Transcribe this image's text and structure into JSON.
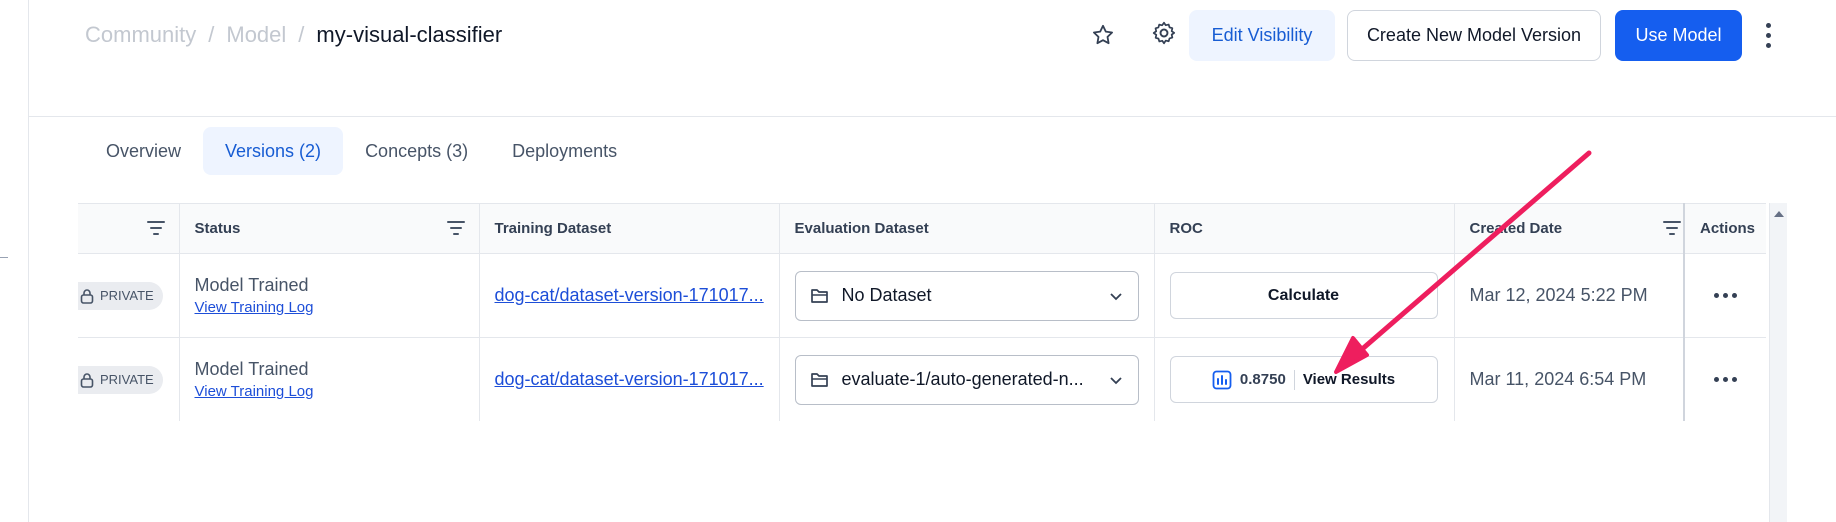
{
  "header": {
    "breadcrumb": [
      "Community",
      "Model",
      "my-visual-classifier"
    ],
    "separator": "/",
    "edit_visibility_label": "Edit Visibility",
    "create_version_label": "Create New Model Version",
    "use_model_label": "Use Model"
  },
  "tabs": [
    {
      "label": "Overview",
      "active": false
    },
    {
      "label": "Versions (2)",
      "active": true
    },
    {
      "label": "Concepts (3)",
      "active": false
    },
    {
      "label": "Deployments",
      "active": false
    }
  ],
  "table": {
    "columns": [
      "",
      "Status",
      "Training Dataset",
      "Evaluation Dataset",
      "ROC",
      "Created Date",
      "Actions"
    ],
    "rows": [
      {
        "visibility": "PRIVATE",
        "status": "Model Trained",
        "status_link": "View Training Log",
        "training_dataset": "dog-cat/dataset-version-171017...",
        "evaluation_dataset": "No Dataset",
        "roc_button": "Calculate",
        "roc_value": "",
        "roc_link": "",
        "created": "Mar 12, 2024 5:22 PM"
      },
      {
        "visibility": "PRIVATE",
        "status": "Model Trained",
        "status_link": "View Training Log",
        "training_dataset": "dog-cat/dataset-version-171017...",
        "evaluation_dataset": "evaluate-1/auto-generated-n...",
        "roc_button": "",
        "roc_value": "0.8750",
        "roc_link": "View Results",
        "created": "Mar 11, 2024 6:54 PM"
      }
    ]
  },
  "colors": {
    "primary": "#155eef",
    "primary_light": "#eef4ff",
    "annotation_arrow": "#ee1e5e"
  },
  "icons": [
    "star-icon",
    "gear-icon",
    "kebab-menu-icon",
    "filter-icon",
    "lock-icon",
    "folder-icon",
    "chevron-down-icon",
    "bar-chart-icon"
  ]
}
